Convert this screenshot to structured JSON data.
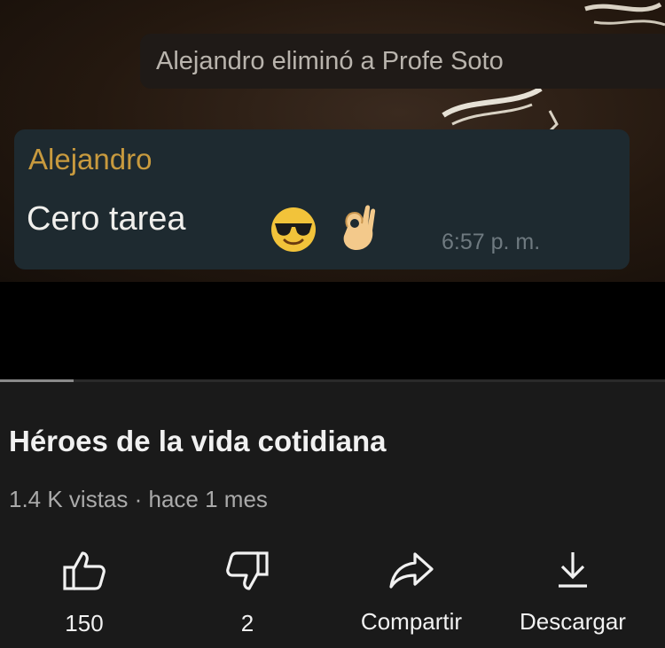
{
  "chat": {
    "system_message": "Alejandro eliminó a Profe Soto",
    "message": {
      "sender": "Alejandro",
      "text": "Cero tarea",
      "emojis": [
        "sunglasses-face-icon",
        "ok-hand-icon"
      ],
      "time": "6:57 p. m."
    },
    "colors": {
      "sender": "#c89a3e",
      "bubble": "#1e2a30"
    }
  },
  "video": {
    "progress": 0.11,
    "title": "Héroes de la vida cotidiana",
    "meta": "1.4 K vistas · hace 1 mes"
  },
  "actions": {
    "like": {
      "icon": "thumbs-up-icon",
      "label": "150"
    },
    "dislike": {
      "icon": "thumbs-down-icon",
      "label": "2"
    },
    "share": {
      "icon": "share-arrow-icon",
      "label": "Compartir"
    },
    "download": {
      "icon": "download-icon",
      "label": "Descargar"
    }
  }
}
